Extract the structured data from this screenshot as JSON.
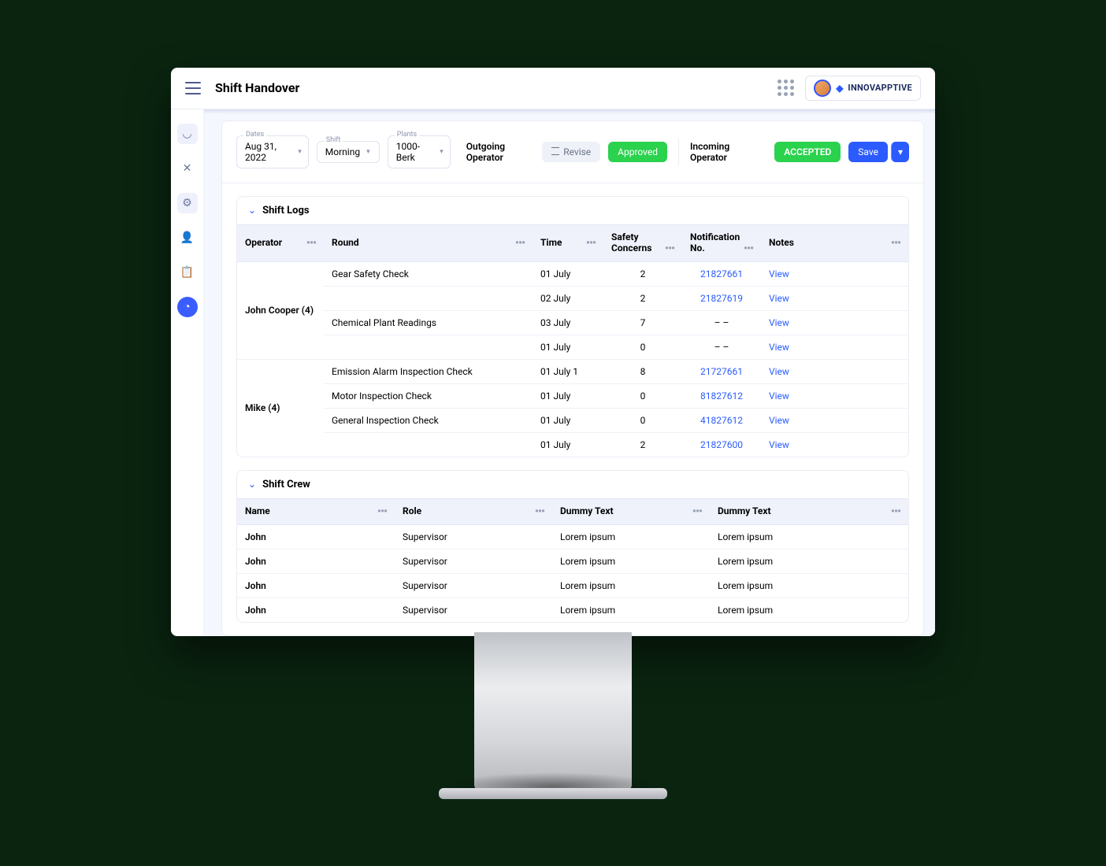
{
  "header": {
    "title": "Shift Handover",
    "brand": "INNOVAPPTIVE"
  },
  "filters": {
    "dates": {
      "label": "Dates",
      "value": "Aug 31, 2022"
    },
    "shift": {
      "label": "Shift",
      "value": "Morning"
    },
    "plants": {
      "label": "Plants",
      "value": "1000-Berk"
    }
  },
  "bar": {
    "outgoing": "Outgoing Operator",
    "revise": "Revise",
    "approved": "Approved",
    "incoming": "Incoming Operator",
    "accepted": "ACCEPTED",
    "save": "Save"
  },
  "logs": {
    "title": "Shift Logs",
    "cols": {
      "operator": "Operator",
      "round": "Round",
      "time": "Time",
      "safety": "Safety Concerns",
      "notif": "Notification No.",
      "notes": "Notes"
    },
    "groups": [
      {
        "operator": "John Cooper (4)",
        "rows": [
          {
            "round": "Gear Safety Check",
            "time": "01 July",
            "safety": "2",
            "notif": "21827661",
            "notes": "View"
          },
          {
            "round": "",
            "time": "02 July",
            "safety": "2",
            "notif": "21827619",
            "notes": "View"
          },
          {
            "round": "Chemical Plant Readings",
            "time": "03 July",
            "safety": "7",
            "notif": "– –",
            "notes": "View"
          },
          {
            "round": "",
            "time": "01 July",
            "safety": "0",
            "notif": "– –",
            "notes": "View"
          }
        ]
      },
      {
        "operator": "Mike (4)",
        "rows": [
          {
            "round": "Emission Alarm Inspection Check",
            "time": "01 July 1",
            "safety": "8",
            "notif": "21727661",
            "notes": "View"
          },
          {
            "round": "Motor Inspection Check",
            "time": "01 July",
            "safety": "0",
            "notif": "81827612",
            "notes": "View"
          },
          {
            "round": "General Inspection Check",
            "time": "01 July",
            "safety": "0",
            "notif": "41827612",
            "notes": "View"
          },
          {
            "round": "",
            "time": "01 July",
            "safety": "2",
            "notif": "21827600",
            "notes": "View"
          }
        ]
      }
    ]
  },
  "crew": {
    "title": "Shift Crew",
    "cols": {
      "name": "Name",
      "role": "Role",
      "d1": "Dummy Text",
      "d2": "Dummy Text"
    },
    "rows": [
      {
        "name": "John",
        "role": "Supervisor",
        "d1": "Lorem ipsum",
        "d2": "Lorem ipsum"
      },
      {
        "name": "John",
        "role": "Supervisor",
        "d1": "Lorem ipsum",
        "d2": "Lorem ipsum"
      },
      {
        "name": "John",
        "role": "Supervisor",
        "d1": "Lorem ipsum",
        "d2": "Lorem ipsum"
      },
      {
        "name": "John",
        "role": "Supervisor",
        "d1": "Lorem ipsum",
        "d2": "Lorem ipsum"
      }
    ]
  }
}
